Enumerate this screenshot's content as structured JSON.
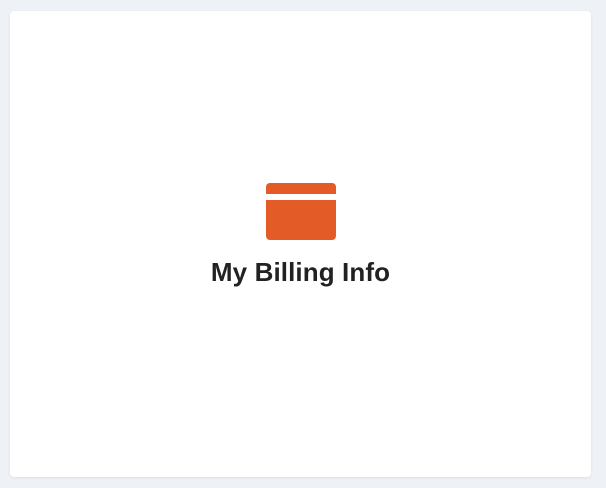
{
  "card": {
    "title": "My Billing Info",
    "icon": "credit-card-icon",
    "accent_color": "#e35b27"
  }
}
